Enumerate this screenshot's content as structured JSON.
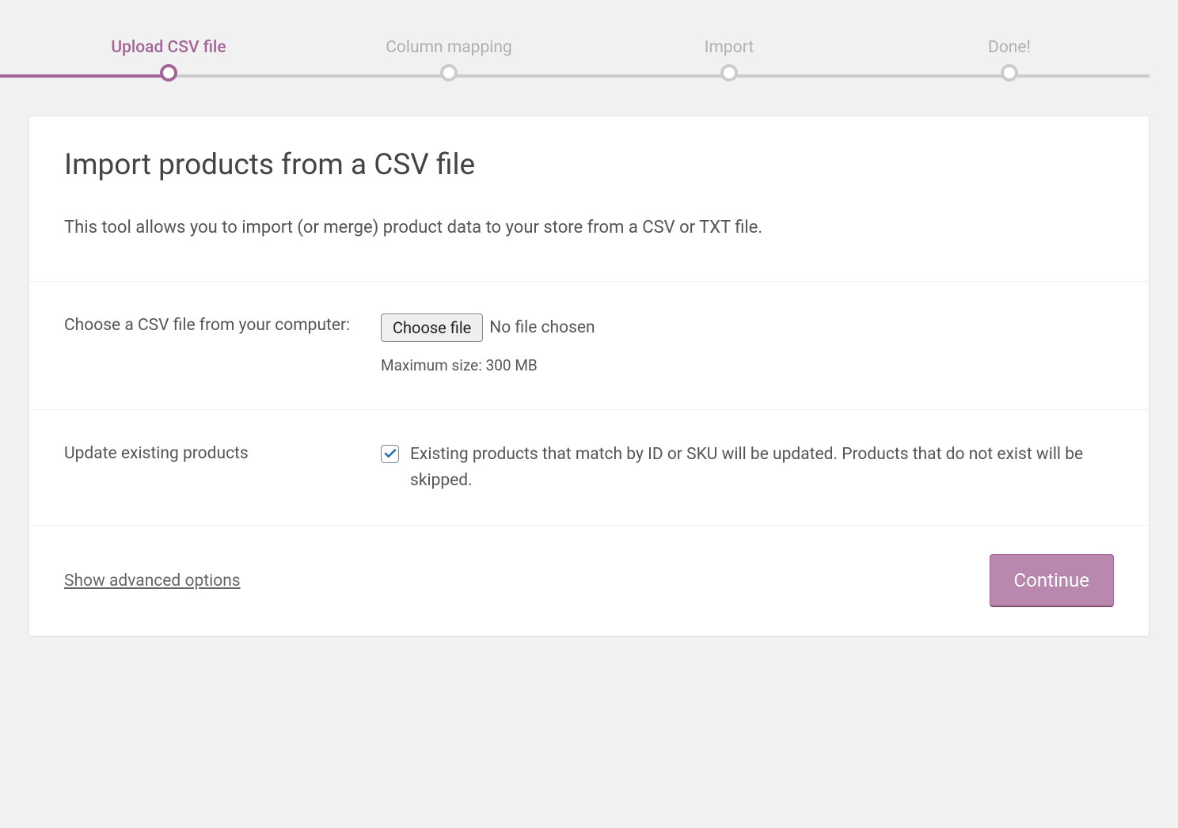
{
  "steps": {
    "s1": "Upload CSV file",
    "s2": "Column mapping",
    "s3": "Import",
    "s4": "Done!"
  },
  "header": {
    "title": "Import products from a CSV file",
    "description": "This tool allows you to import (or merge) product data to your store from a CSV or TXT file."
  },
  "form": {
    "file_label": "Choose a CSV file from your computer:",
    "choose_file_button": "Choose file",
    "file_status": "No file chosen",
    "max_size_hint": "Maximum size: 300 MB",
    "update_label": "Update existing products",
    "update_description": "Existing products that match by ID or SKU will be updated. Products that do not exist will be skipped.",
    "update_checked": true
  },
  "footer": {
    "advanced_link": "Show advanced options",
    "continue_button": "Continue"
  }
}
